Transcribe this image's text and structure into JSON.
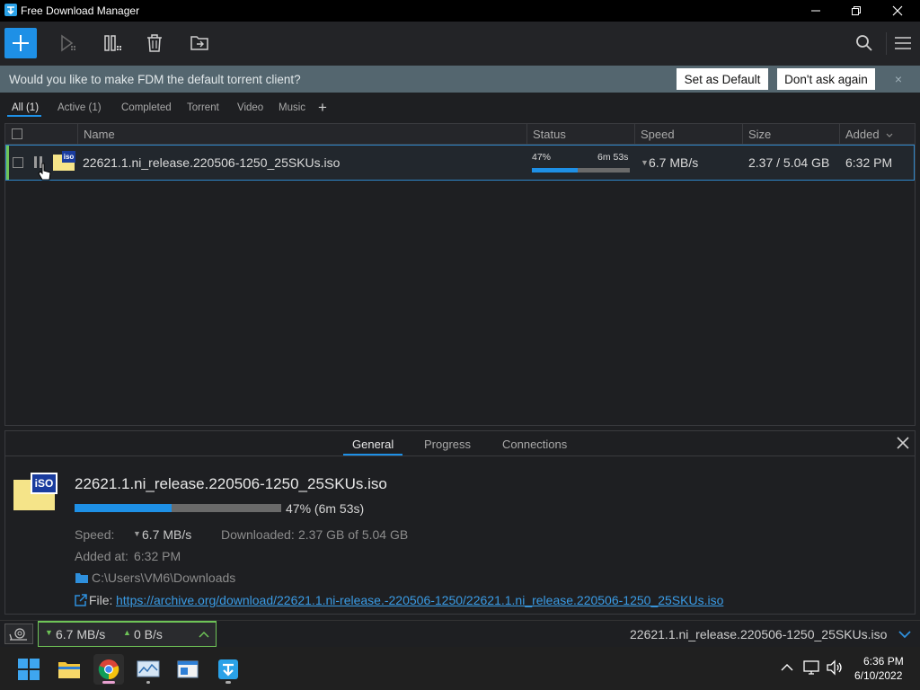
{
  "window": {
    "title": "Free Download Manager"
  },
  "banner": {
    "message": "Would you like to make FDM the default torrent client?",
    "set_default": "Set as Default",
    "dont_ask": "Don't ask again",
    "close": "×"
  },
  "filters": {
    "all": "All (1)",
    "active": "Active (1)",
    "completed": "Completed",
    "torrent": "Torrent",
    "video": "Video",
    "music": "Music",
    "add": "+"
  },
  "list": {
    "columns": {
      "name": "Name",
      "status": "Status",
      "speed": "Speed",
      "size": "Size",
      "added": "Added"
    },
    "rows": [
      {
        "icon_label": "iso",
        "name": "22621.1.ni_release.220506-1250_25SKUs.iso",
        "percent": "47%",
        "eta": "6m 53s",
        "progress": 0.47,
        "speed": "6.7 MB/s",
        "size": "2.37 / 5.04 GB",
        "added": "6:32 PM"
      }
    ]
  },
  "details": {
    "tabs": {
      "general": "General",
      "progress": "Progress",
      "connections": "Connections"
    },
    "icon_label": "iSO",
    "filename": "22621.1.ni_release.220506-1250_25SKUs.iso",
    "progress_text": "47% (6m 53s)",
    "progress": 0.47,
    "speed_label": "Speed:",
    "speed_value": "6.7 MB/s",
    "downloaded_label": "Downloaded:",
    "downloaded_value": "2.37 GB of 5.04 GB",
    "added_label": "Added at:",
    "added_value": "6:32 PM",
    "folder": "C:\\Users\\VM6\\Downloads",
    "file_label": "File:",
    "url": "https://archive.org/download/22621.1.ni-release.-220506-1250/22621.1.ni_release.220506-1250_25SKUs.iso"
  },
  "statusbar": {
    "down_speed": "6.7 MB/s",
    "up_speed": "0 B/s",
    "current_file": "22621.1.ni_release.220506-1250_25SKUs.iso"
  },
  "taskbar": {
    "time": "6:36 PM",
    "date": "6/10/2022"
  },
  "colors": {
    "accent": "#1e90e6",
    "active_green": "#6ec457",
    "banner": "#54666f"
  }
}
